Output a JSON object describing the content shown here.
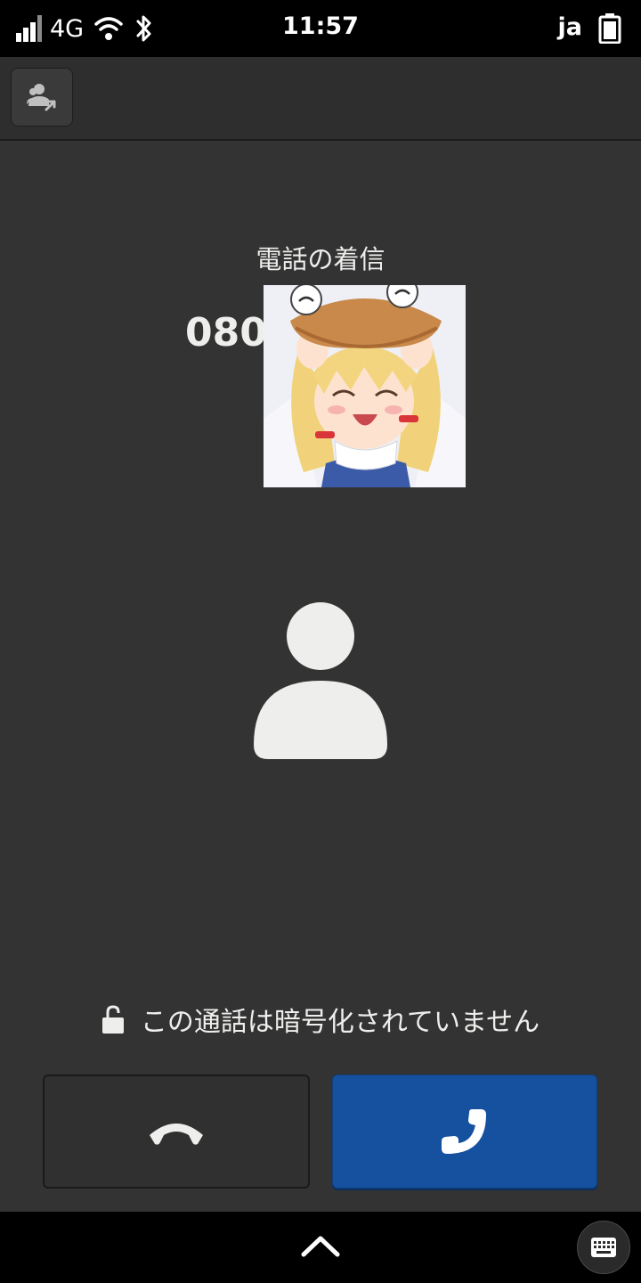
{
  "status_bar": {
    "network_type": "4G",
    "time": "11:57",
    "input_language": "ja",
    "icons": [
      "cellular-signal-icon",
      "wifi-icon",
      "bluetooth-icon",
      "battery-icon"
    ]
  },
  "header": {
    "contacts_button_icon": "contact-forward-icon"
  },
  "call": {
    "state_label": "電話の着信",
    "caller_number": "080",
    "caller_image": "anime-character-photo",
    "avatar_icon": "person-placeholder-icon",
    "encryption_status": "この通話は暗号化されていません",
    "decline_icon": "phone-hangup-icon",
    "accept_icon": "phone-answer-icon"
  },
  "nav": {
    "home_icon": "chevron-up-icon",
    "keyboard_icon": "keyboard-icon"
  },
  "colors": {
    "background": "#333333",
    "accept_button": "#1651a0",
    "status_bar": "#000000",
    "text": "#eeeeec"
  }
}
